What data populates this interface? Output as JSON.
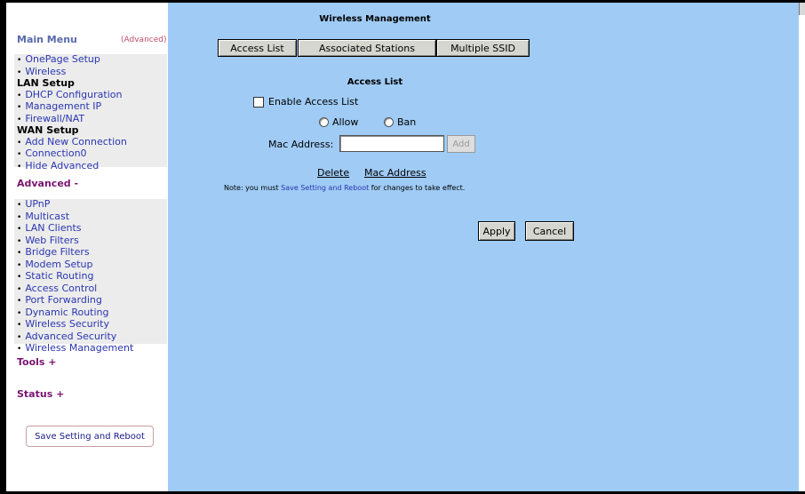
{
  "sidebar": {
    "main_menu": "Main Menu",
    "advanced_link": "(Advanced)",
    "main_items": [
      {
        "type": "item",
        "label": "OnePage Setup"
      },
      {
        "type": "item",
        "label": "Wireless"
      },
      {
        "type": "group",
        "label": "LAN Setup"
      },
      {
        "type": "item",
        "label": "DHCP Configuration"
      },
      {
        "type": "item",
        "label": "Management IP"
      },
      {
        "type": "item",
        "label": "Firewall/NAT"
      },
      {
        "type": "group",
        "label": "WAN Setup"
      },
      {
        "type": "item",
        "label": "Add New Connection"
      },
      {
        "type": "item",
        "label": "Connection0"
      },
      {
        "type": "item",
        "label": "Hide Advanced"
      }
    ],
    "advanced_head": "Advanced -",
    "advanced_items": [
      "UPnP",
      "Multicast",
      "LAN Clients",
      "Web Filters",
      "Bridge Filters",
      "Modem Setup",
      "Static Routing",
      "Access Control",
      "Port Forwarding",
      "Dynamic Routing",
      "Wireless Security",
      "Advanced Security",
      "Wireless Management"
    ],
    "tools_head": "Tools +",
    "status_head": "Status +",
    "save_button": "Save Setting and Reboot"
  },
  "main": {
    "title": "Wireless Management",
    "tabs": [
      "Access List",
      "Associated Stations",
      "Multiple SSID"
    ],
    "section_title": "Access List",
    "enable_label": "Enable Access List",
    "enable_checked": false,
    "radio_allow": "Allow",
    "radio_ban": "Ban",
    "mac_label": "Mac Address:",
    "mac_value": "",
    "add_button": "Add",
    "col_delete": "Delete",
    "col_mac": "Mac Address",
    "note_prefix": "Note: you must ",
    "note_link": "Save Setting and Reboot",
    "note_suffix": " for changes to take effect.",
    "apply": "Apply",
    "cancel": "Cancel"
  },
  "colors": {
    "main_bg": "#9fcbf5",
    "link": "#2a36b0",
    "section": "#7a1470"
  }
}
